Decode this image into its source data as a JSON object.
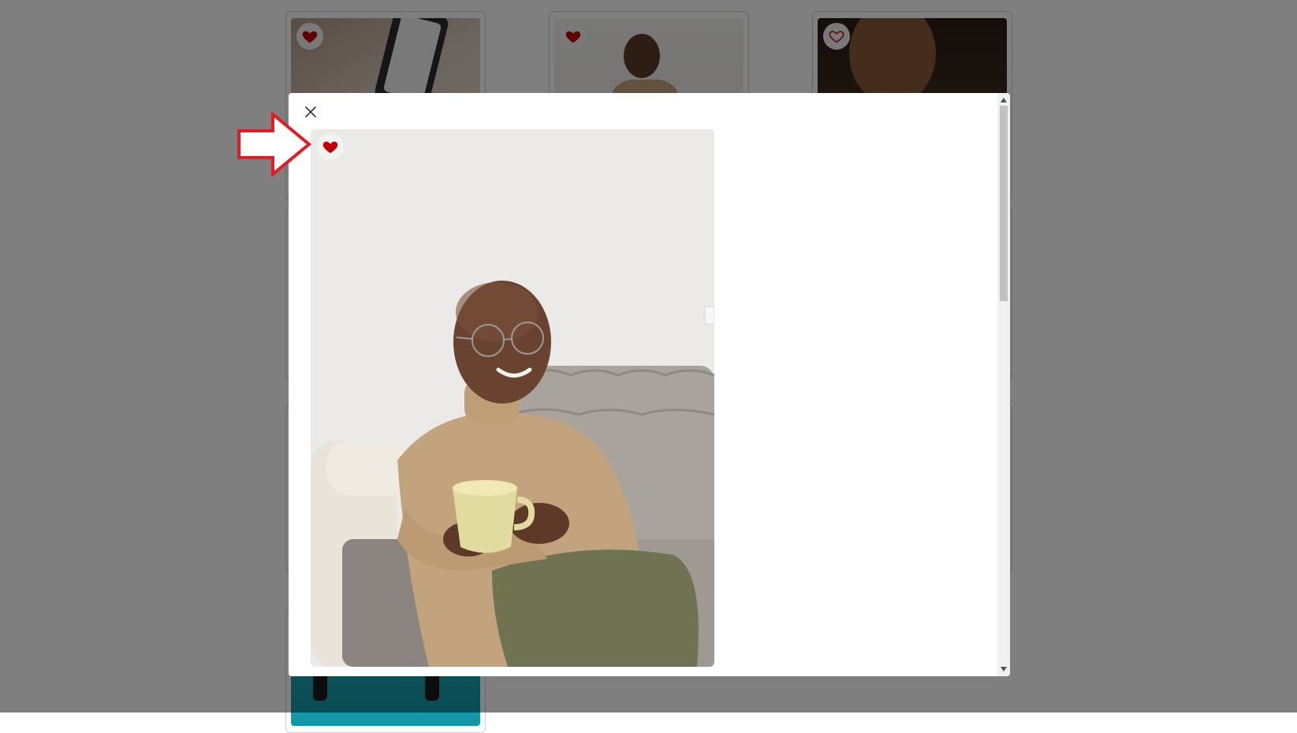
{
  "gallery": {
    "cards": [
      {
        "name": "phone-photo-card",
        "favorited": true
      },
      {
        "name": "man-photo-card",
        "favorited": true
      },
      {
        "name": "woman-photo-card",
        "favorited": false
      },
      {
        "name": "man-backpack-photo-card",
        "favorited": false
      }
    ]
  },
  "modal": {
    "close_icon": "close-icon",
    "photo": {
      "subject": "man-with-cup-photo",
      "favorited": true,
      "heart_icon": "heart-filled-icon"
    },
    "scrollbar": {
      "position_fraction": 0.0,
      "visible_fraction": 0.35
    }
  },
  "annotation": {
    "arrow_icon": "right-arrow-icon",
    "color": "#e41b23"
  },
  "colors": {
    "heart": "#c00000",
    "overlay": "rgba(0,0,0,0.5)"
  }
}
